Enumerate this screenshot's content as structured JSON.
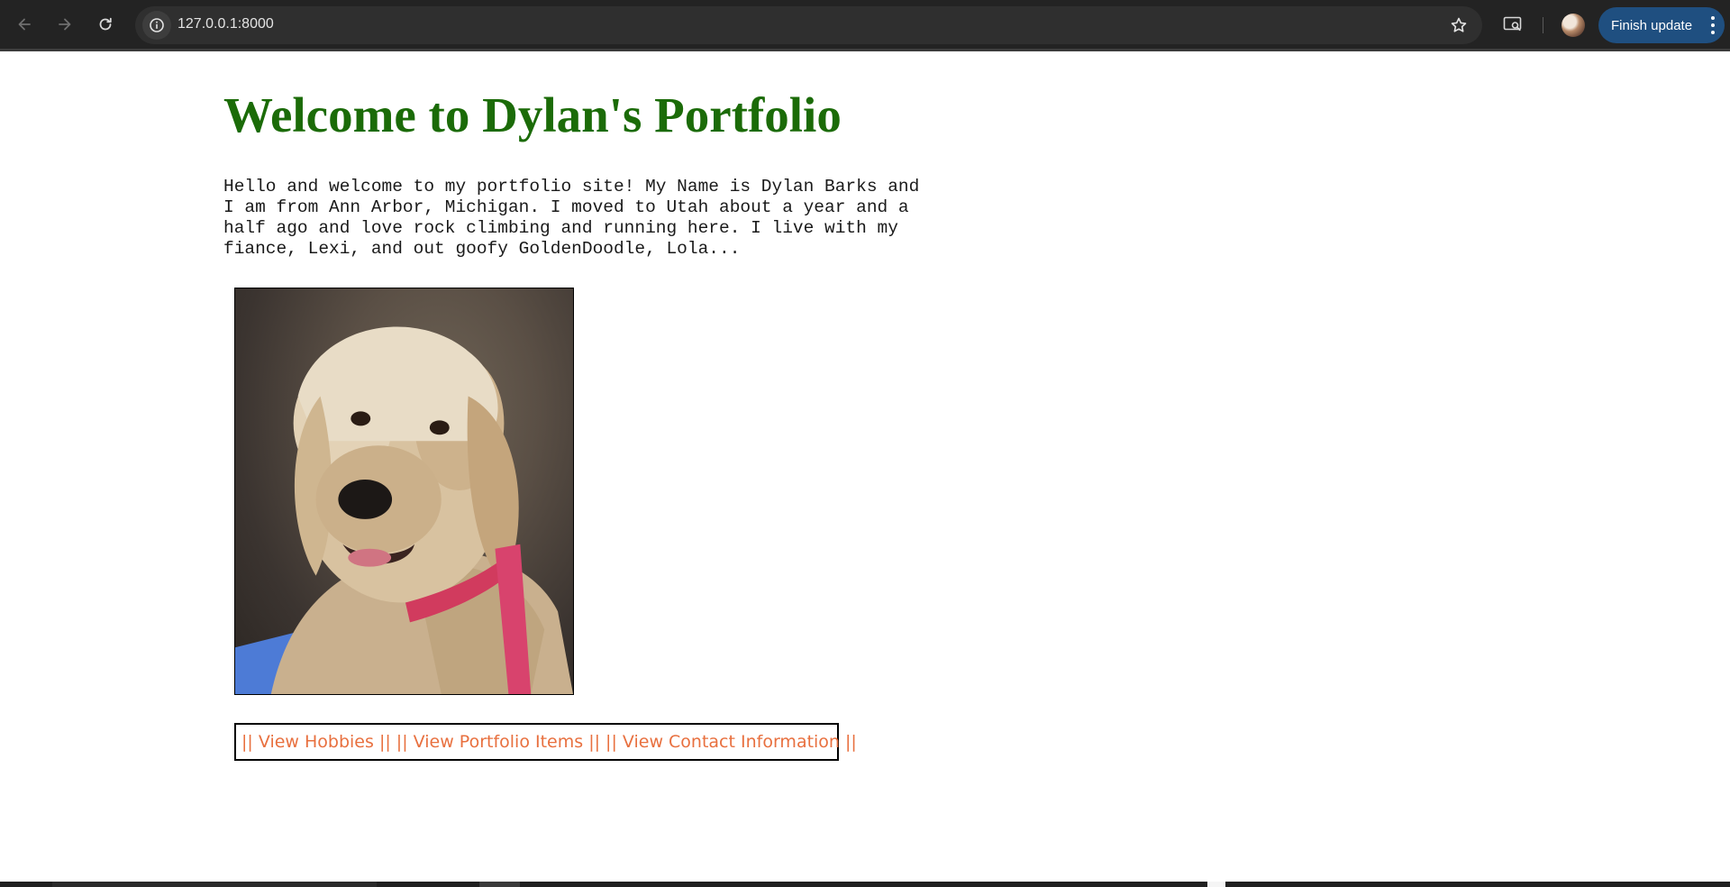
{
  "browser": {
    "url": "127.0.0.1:8000",
    "update_button_label": "Finish update",
    "icons": {
      "back": "arrow-left-icon",
      "forward": "arrow-right-icon",
      "reload": "reload-icon",
      "site_info": "info-icon",
      "bookmark": "star-icon",
      "cast": "media-search-icon",
      "menu": "kebab-menu-icon"
    }
  },
  "page": {
    "title": "Welcome to Dylan's Portfolio",
    "intro_lines": [
      "Hello and welcome to my portfolio site! My Name is Dylan Barks and",
      "I am from Ann Arbor, Michigan. I moved to Utah about a year and a",
      "half ago and love rock climbing and running here. I live with my",
      "fiance, Lexi, and out goofy GoldenDoodle, Lola..."
    ],
    "nav": {
      "separator": "||",
      "links": [
        "View Hobbies",
        "View Portfolio Items",
        "View Contact Information"
      ]
    }
  },
  "colors": {
    "title": "#1b6b08",
    "link": "#e8703f",
    "update_button": "#1f4f80",
    "toolbar": "#232323"
  }
}
